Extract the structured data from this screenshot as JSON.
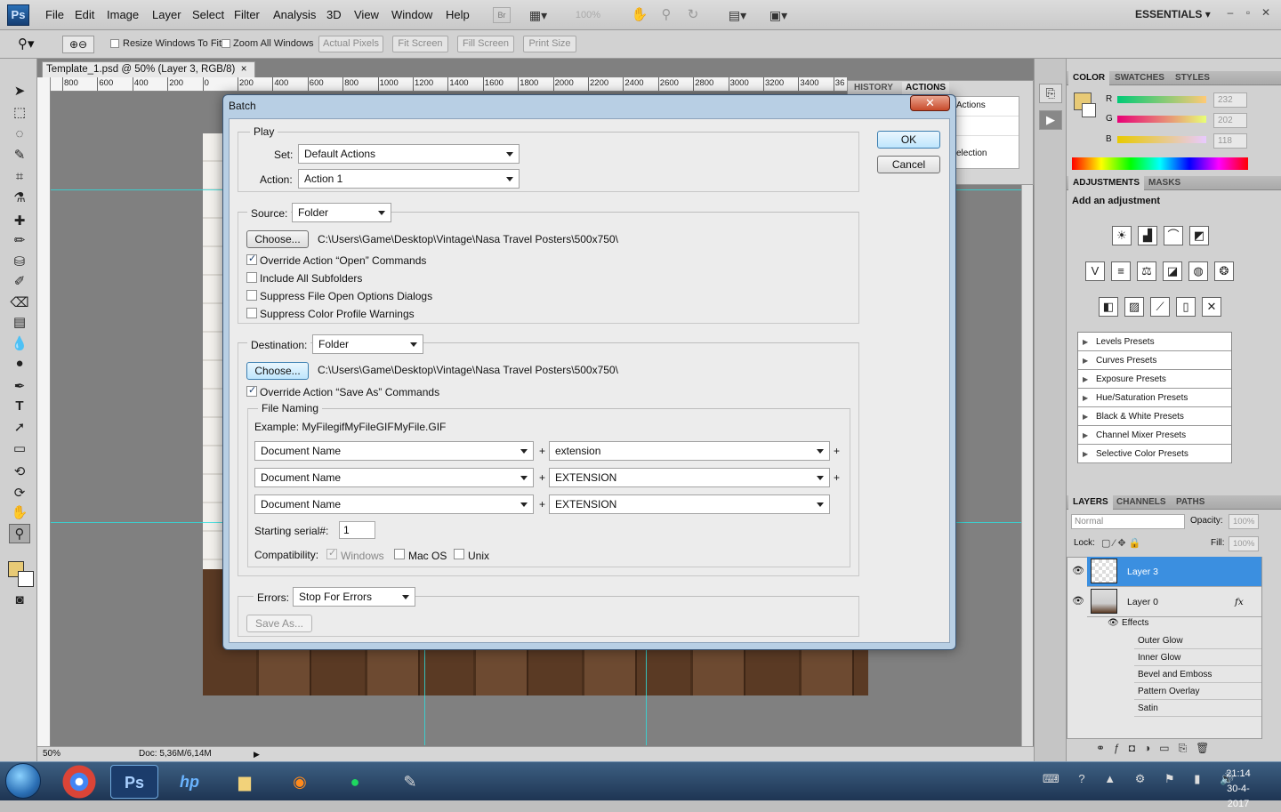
{
  "app": {
    "logo": "Ps",
    "menu": [
      "File",
      "Edit",
      "Image",
      "Layer",
      "Select",
      "Filter",
      "Analysis",
      "3D",
      "View",
      "Window",
      "Help"
    ],
    "zoom_box": "100%",
    "workspace": "ESSENTIALS",
    "window_controls": [
      "–",
      "▫",
      "✕"
    ]
  },
  "options_bar": {
    "resize_windows": "Resize Windows To Fit",
    "zoom_all": "Zoom All Windows",
    "actual_pixels": "Actual Pixels",
    "fit_screen": "Fit Screen",
    "fill_screen": "Fill Screen",
    "print_size": "Print Size"
  },
  "document": {
    "tab_title": "Template_1.psd @ 50% (Layer 3, RGB/8)",
    "tab_close": "×",
    "ruler_marks": [
      "800",
      "600",
      "400",
      "200",
      "0",
      "200",
      "400",
      "600",
      "800",
      "1000",
      "1200",
      "1400",
      "1600",
      "1800",
      "2000",
      "2200",
      "2400",
      "2600",
      "2800",
      "3000",
      "3200",
      "3400",
      "36"
    ],
    "zoom": "50%",
    "doc_size": "Doc: 5,36M/6,14M"
  },
  "history_panel": {
    "tabs": [
      "HISTORY",
      "ACTIONS"
    ],
    "items": [
      "Actions",
      "",
      "election"
    ]
  },
  "color_panel": {
    "tabs": [
      "COLOR",
      "SWATCHES",
      "STYLES"
    ],
    "channels": [
      {
        "label": "R",
        "value": "232"
      },
      {
        "label": "G",
        "value": "202"
      },
      {
        "label": "B",
        "value": "118"
      }
    ],
    "foreground": "#e8ca76"
  },
  "adjustments_panel": {
    "tabs": [
      "ADJUSTMENTS",
      "MASKS"
    ],
    "heading": "Add an adjustment",
    "presets": [
      "Levels Presets",
      "Curves Presets",
      "Exposure Presets",
      "Hue/Saturation Presets",
      "Black & White Presets",
      "Channel Mixer Presets",
      "Selective Color Presets"
    ]
  },
  "layers_panel": {
    "tabs": [
      "LAYERS",
      "CHANNELS",
      "PATHS"
    ],
    "blend_mode": "Normal",
    "opacity_label": "Opacity:",
    "opacity": "100%",
    "lock_label": "Lock:",
    "fill_label": "Fill:",
    "fill": "100%",
    "layers": [
      "Layer 3",
      "Layer 0"
    ],
    "effects_label": "Effects",
    "effects": [
      "Outer Glow",
      "Inner Glow",
      "Bevel and Emboss",
      "Pattern Overlay",
      "Satin"
    ],
    "fx": "fx"
  },
  "dialog": {
    "title": "Batch",
    "close": "✕",
    "ok": "OK",
    "cancel": "Cancel",
    "play": {
      "legend": "Play",
      "set_label": "Set:",
      "set_value": "Default Actions",
      "action_label": "Action:",
      "action_value": "Action 1"
    },
    "source": {
      "label": "Source:",
      "value": "Folder",
      "choose": "Choose...",
      "path": "C:\\Users\\Game\\Desktop\\Vintage\\Nasa Travel Posters\\500x750\\",
      "override_open": "Override Action “Open” Commands",
      "include_subfolders": "Include All Subfolders",
      "suppress_open": "Suppress File Open Options Dialogs",
      "suppress_profile": "Suppress Color Profile Warnings"
    },
    "destination": {
      "label": "Destination:",
      "value": "Folder",
      "choose": "Choose...",
      "path": "C:\\Users\\Game\\Desktop\\Vintage\\Nasa Travel Posters\\500x750\\",
      "override_save": "Override Action “Save As” Commands"
    },
    "file_naming": {
      "legend": "File Naming",
      "example": "Example: MyFilegifMyFileGIFMyFile.GIF",
      "rows": [
        {
          "left": "Document Name",
          "right": "extension"
        },
        {
          "left": "Document Name",
          "right": "EXTENSION"
        },
        {
          "left": "Document Name",
          "right": "EXTENSION"
        }
      ],
      "plus": "+",
      "serial_label": "Starting serial#:",
      "serial_value": "1",
      "compat_label": "Compatibility:",
      "windows": "Windows",
      "macos": "Mac OS",
      "unix": "Unix"
    },
    "errors": {
      "label": "Errors:",
      "value": "Stop For Errors",
      "save_as": "Save As..."
    }
  },
  "taskbar": {
    "time": "21:14",
    "date": "30-4-2017",
    "apps": [
      "chrome",
      "Ps",
      "hp",
      "explorer",
      "firefox",
      "spotify",
      "paint"
    ]
  }
}
